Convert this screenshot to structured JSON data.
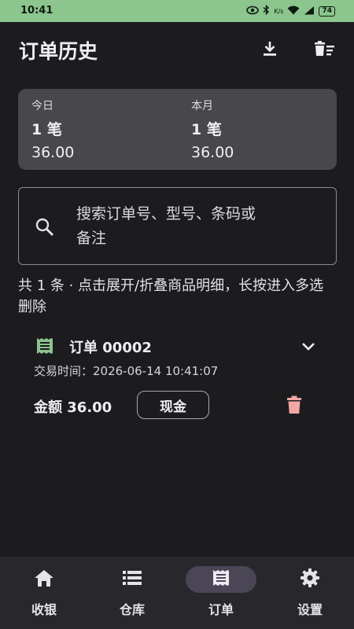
{
  "status_bar": {
    "time": "10:41",
    "network_badge": "K/s",
    "battery": "74"
  },
  "app_bar": {
    "title": "订单历史"
  },
  "summary": {
    "today": {
      "label": "今日",
      "count": "1 笔",
      "amount": "36.00"
    },
    "month": {
      "label": "本月",
      "count": "1 笔",
      "amount": "36.00"
    }
  },
  "search": {
    "placeholder": "搜索订单号、型号、条码或备注"
  },
  "hint": "共 1 条 · 点击展开/折叠商品明细，长按进入多选删除",
  "orders": [
    {
      "title": "订单 00002",
      "time": "交易时间：2026-06-14 10:41:07",
      "amount": "金额 36.00",
      "payment": "现金"
    }
  ],
  "nav": {
    "items": [
      {
        "label": "收银",
        "icon": "home-icon"
      },
      {
        "label": "仓库",
        "icon": "list-icon"
      },
      {
        "label": "订单",
        "icon": "receipt-icon"
      },
      {
        "label": "设置",
        "icon": "gear-icon"
      }
    ],
    "active_index": 2
  },
  "colors": {
    "accent_green": "#8cc58e",
    "delete_pink": "#f2a7a7",
    "background": "#1c1c1f",
    "card": "#48474c"
  }
}
